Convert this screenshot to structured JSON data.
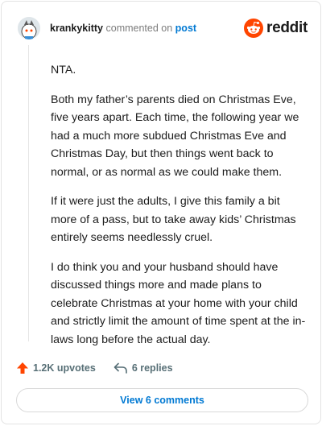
{
  "comment": {
    "username": "krankykitty",
    "commented_text": "commented on",
    "post_link": "post",
    "brand": "reddit",
    "paragraphs": [
      "NTA.",
      "Both my father’s parents died on Christmas Eve, five years apart. Each time, the following year we had a much more subdued Christmas Eve and Christmas Day, but then things went back to normal, or as normal as we could make them.",
      "If it were just the adults, I give this family a bit more of a pass, but to take away kids’ Christmas entirely seems needlessly cruel.",
      "I do think you and your husband should have discussed things more and made plans to celebrate Christmas at your home with your child and strictly limit the amount of time spent at the in-laws long before the actual day."
    ]
  },
  "actions": {
    "upvotes": "1.2K upvotes",
    "replies": "6 replies",
    "view_comments": "View 6 comments"
  },
  "icons": {
    "avatar": "snoo-avatar-icon",
    "brand": "reddit-logo-icon",
    "upvote": "upvote-arrow-icon",
    "reply": "reply-arrow-icon"
  },
  "colors": {
    "brand_orange": "#ff4500",
    "link_blue": "#0079d3",
    "upvote_orange": "#ff4500"
  }
}
